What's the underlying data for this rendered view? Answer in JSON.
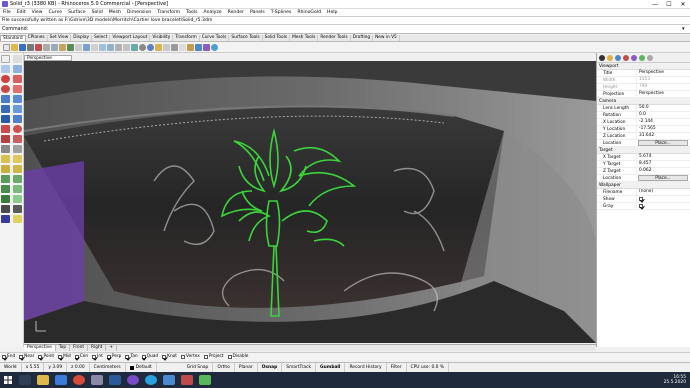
{
  "window": {
    "title": "Solid_r3 (3380 KB) - Rhinoceros 5.0 Commercial - [Perspective]",
    "min": "—",
    "max": "☐",
    "close": "✕"
  },
  "menu": [
    "File",
    "Edit",
    "View",
    "Curve",
    "Surface",
    "Solid",
    "Mesh",
    "Dimension",
    "Transform",
    "Tools",
    "Analyze",
    "Render",
    "Panels",
    "T-Splines",
    "RhinoGold",
    "Help"
  ],
  "command_history": "File successfully written as F:\\Gdrive\\3D models\\Morritch\\Cartier love bracelet\\Solid_r5.3dm",
  "command": {
    "label": "Command",
    "value": ""
  },
  "toolbar_tabs": [
    "Standard",
    "CPlanes",
    "Set View",
    "Display",
    "Select",
    "Viewport Layout",
    "Visibility",
    "Transform",
    "Curve Tools",
    "Surface Tools",
    "Solid Tools",
    "Mesh Tools",
    "Render Tools",
    "Drafting",
    "New in V5"
  ],
  "active_toolbar_tab": "Standard",
  "viewport_title": "Perspective",
  "viewport_tabs": [
    "Perspective",
    "Top",
    "Front",
    "Right",
    "+"
  ],
  "osnaps": [
    {
      "label": "End",
      "on": true
    },
    {
      "label": "Near",
      "on": true
    },
    {
      "label": "Point",
      "on": true
    },
    {
      "label": "Mid",
      "on": true
    },
    {
      "label": "Cen",
      "on": true
    },
    {
      "label": "Int",
      "on": true
    },
    {
      "label": "Perp",
      "on": true
    },
    {
      "label": "Tan",
      "on": true
    },
    {
      "label": "Quad",
      "on": true
    },
    {
      "label": "Knot",
      "on": true
    },
    {
      "label": "Vertex",
      "on": false
    },
    {
      "label": "Project",
      "on": false
    },
    {
      "label": "Disable",
      "on": false
    }
  ],
  "status": {
    "cplane": "World",
    "x": "x 5.55",
    "y": "y 3.09",
    "z": "z 0.00",
    "units": "Centimeters",
    "layer": "Default",
    "buttons": [
      "Grid Snap",
      "Ortho",
      "Planar",
      "Osnap",
      "SmartTrack",
      "Gumball",
      "Record History",
      "Filter"
    ],
    "bold_buttons": [
      "Osnap",
      "Gumball"
    ],
    "cpu": "CPU use: 0.0 %"
  },
  "properties": {
    "viewport_header": "Viewport",
    "viewport_rows": [
      {
        "k": "Title",
        "v": "Perspective",
        "grey": false
      },
      {
        "k": "Width",
        "v": "1553",
        "grey": true
      },
      {
        "k": "Height",
        "v": "790",
        "grey": true
      },
      {
        "k": "Projection",
        "v": "Perspective",
        "grey": false
      }
    ],
    "camera_header": "Camera",
    "camera_rows": [
      {
        "k": "Lens Length",
        "v": "50.0"
      },
      {
        "k": "Rotation",
        "v": "0.0"
      },
      {
        "k": "X Location",
        "v": "-2.144"
      },
      {
        "k": "Y Location",
        "v": "-17.565"
      },
      {
        "k": "Z Location",
        "v": "31.642"
      }
    ],
    "place_label": "Place...",
    "location_label": "Location",
    "target_header": "Target",
    "target_rows": [
      {
        "k": "X Target",
        "v": "5.674"
      },
      {
        "k": "Y Target",
        "v": "8.457"
      },
      {
        "k": "Z Target",
        "v": "0.062"
      }
    ],
    "wallpaper_header": "Wallpaper",
    "wallpaper_rows": [
      {
        "k": "Filename",
        "v": "(none)"
      },
      {
        "k": "Show",
        "v": ""
      },
      {
        "k": "Gray",
        "v": ""
      }
    ]
  },
  "taskbar": {
    "time": "16:55",
    "date": "25.5.2020"
  },
  "colors": {
    "curve_green": "#3bd43b",
    "title_bg": "#ffffff",
    "taskbar": "#1f2a3c"
  }
}
